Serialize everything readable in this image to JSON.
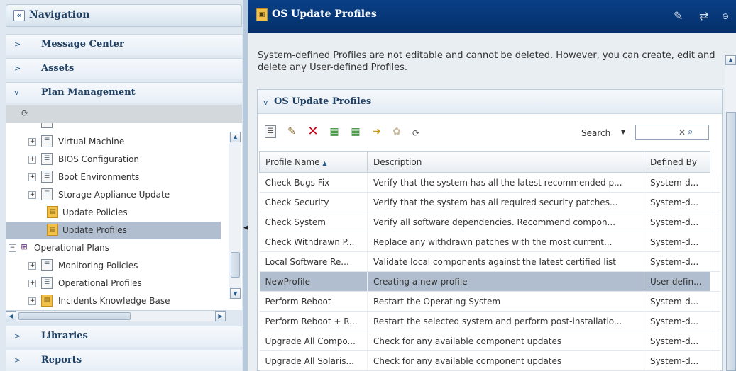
{
  "nav": {
    "collapse_glyph": "«",
    "title": "Navigation",
    "sections": {
      "message_center": "Message Center",
      "assets": "Assets",
      "plan_management": "Plan Management",
      "libraries": "Libraries",
      "reports": "Reports"
    },
    "tree": [
      {
        "label": "Virtual Machine",
        "expander": "+",
        "icon": "document-icon",
        "selected": false
      },
      {
        "label": "BIOS Configuration",
        "expander": "+",
        "icon": "document-icon",
        "selected": false
      },
      {
        "label": "Boot Environments",
        "expander": "+",
        "icon": "document-icon",
        "selected": false
      },
      {
        "label": "Storage Appliance Update",
        "expander": "+",
        "icon": "document-icon",
        "selected": false
      },
      {
        "label": "Update Policies",
        "expander": "",
        "icon": "folder-icon",
        "selected": false
      },
      {
        "label": "Update Profiles",
        "expander": "",
        "icon": "folder-icon",
        "selected": true
      },
      {
        "label": "Operational Plans",
        "expander": "−",
        "icon": "operational-plans-icon",
        "selected": false
      },
      {
        "label": "Monitoring Policies",
        "expander": "+",
        "icon": "document-icon",
        "selected": false
      },
      {
        "label": "Operational Profiles",
        "expander": "+",
        "icon": "document-icon",
        "selected": false
      },
      {
        "label": "Incidents Knowledge Base",
        "expander": "+",
        "icon": "folder-icon",
        "selected": false
      }
    ]
  },
  "content": {
    "title": "OS Update Profiles",
    "info": "System-defined Profiles are not editable and cannot be deleted. However, you can create, edit and delete any User-defined Profiles.",
    "box_title": "OS Update Profiles",
    "search": {
      "label": "Search",
      "value": ""
    },
    "table": {
      "columns": [
        "Profile Name",
        "Description",
        "Defined By"
      ],
      "rows": [
        {
          "name": "Check Bugs Fix",
          "desc": "Verify that the system has all the latest recommended p...",
          "by": "System-d...",
          "selected": false
        },
        {
          "name": "Check Security",
          "desc": "Verify that the system has all required security patches...",
          "by": "System-d...",
          "selected": false
        },
        {
          "name": "Check System",
          "desc": "Verify all software dependencies. Recommend compon...",
          "by": "System-d...",
          "selected": false
        },
        {
          "name": "Check Withdrawn P...",
          "desc": "Replace any withdrawn patches with the most current...",
          "by": "System-d...",
          "selected": false
        },
        {
          "name": "Local Software Re...",
          "desc": "Validate local components against the latest certified list",
          "by": "System-d...",
          "selected": false
        },
        {
          "name": "NewProfile",
          "desc": "Creating a new profile",
          "by": "User-defin...",
          "selected": true
        },
        {
          "name": "Perform Reboot",
          "desc": "Restart the Operating System",
          "by": "System-d...",
          "selected": false
        },
        {
          "name": "Perform Reboot + R...",
          "desc": "Restart the selected system and perform post-installatio...",
          "by": "System-d...",
          "selected": false
        },
        {
          "name": "Upgrade All Compo...",
          "desc": "Check for any available component updates",
          "by": "System-d...",
          "selected": false
        },
        {
          "name": "Upgrade All Solaris...",
          "desc": "Check for any available component updates",
          "by": "System-d...",
          "selected": false
        }
      ]
    }
  },
  "colors": {
    "header_blue": "#0a3f86",
    "selection": "#b0bed0",
    "delete_red": "#d0021b",
    "folder_yellow": "#f2c14a"
  }
}
